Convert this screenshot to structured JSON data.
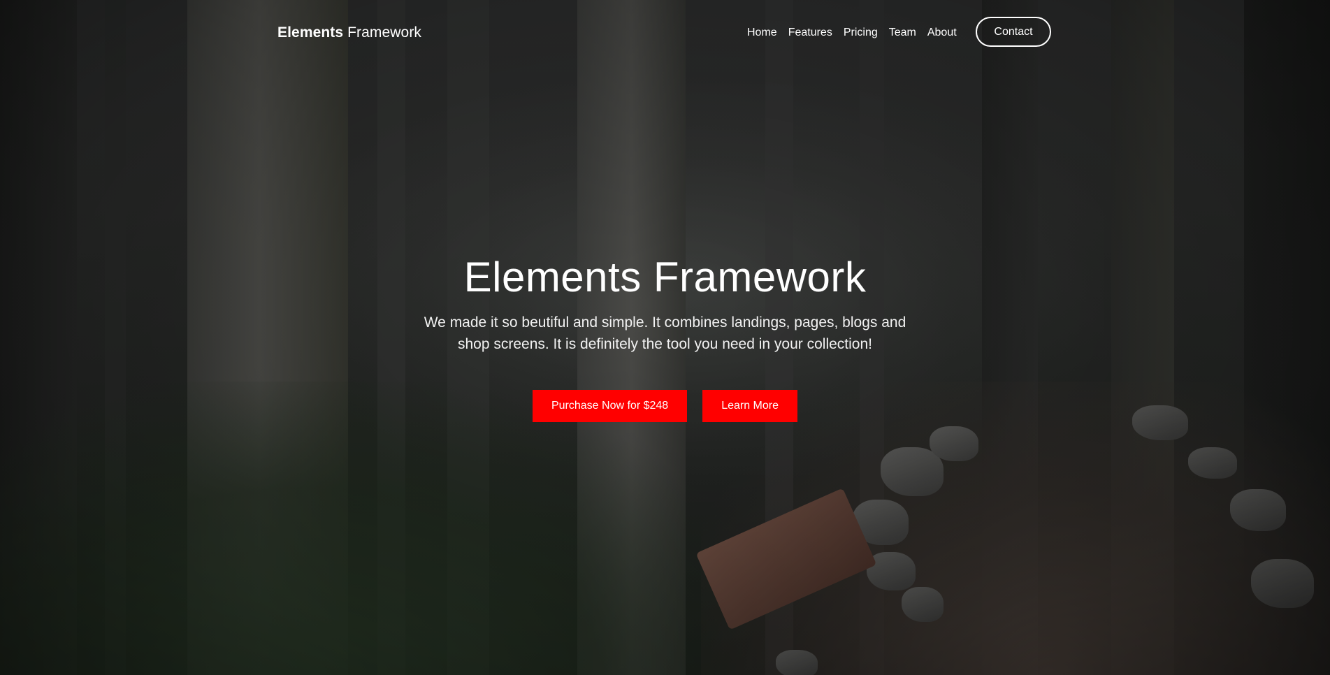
{
  "page": {
    "brand": {
      "bold_part": "Elements",
      "light_part": " Framework"
    },
    "nav": {
      "items": [
        {
          "label": "Home"
        },
        {
          "label": "Features"
        },
        {
          "label": "Pricing"
        },
        {
          "label": "Team"
        },
        {
          "label": "About"
        }
      ],
      "contact_label": "Contact"
    },
    "hero": {
      "title": "Elements Framework",
      "subtitle": "We made it so beutiful and simple. It combines landings, pages, blogs and shop screens. It is definitely the tool you need in your collection!",
      "primary_button": "Purchase Now for $248",
      "secondary_button": "Learn More"
    },
    "colors": {
      "accent": "#ff0000",
      "text": "#ffffff"
    },
    "background": {
      "icon": "forest-trail-photo"
    }
  }
}
